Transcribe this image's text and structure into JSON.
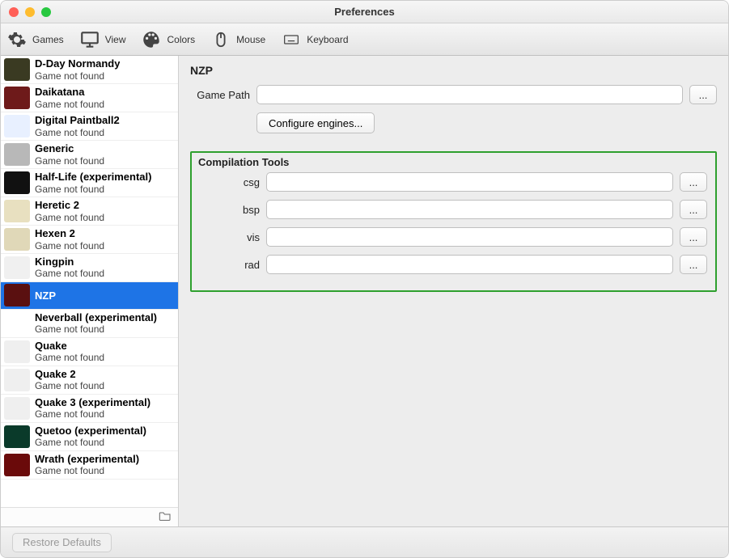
{
  "window": {
    "title": "Preferences"
  },
  "toolbar": {
    "games": "Games",
    "view": "View",
    "colors": "Colors",
    "mouse": "Mouse",
    "keyboard": "Keyboard"
  },
  "sidebar": {
    "not_found": "Game not found",
    "items": [
      {
        "name": "D-Day Normandy",
        "bg": "#3a3a22"
      },
      {
        "name": "Daikatana",
        "bg": "#6e1a1a"
      },
      {
        "name": "Digital Paintball2",
        "bg": "#e8f0ff"
      },
      {
        "name": "Generic",
        "bg": "#b8b8b8"
      },
      {
        "name": "Half-Life (experimental)",
        "bg": "#111"
      },
      {
        "name": "Heretic 2",
        "bg": "#e8e0c0"
      },
      {
        "name": "Hexen 2",
        "bg": "#e0d8b8"
      },
      {
        "name": "Kingpin",
        "bg": "#f0f0f0"
      },
      {
        "name": "NZP",
        "bg": "#5a1010",
        "selected": true,
        "hide_status": true
      },
      {
        "name": "Neverball (experimental)",
        "bg": "",
        "hide_icon": true
      },
      {
        "name": "Quake",
        "bg": "#efefef"
      },
      {
        "name": "Quake 2",
        "bg": "#efefef"
      },
      {
        "name": "Quake 3 (experimental)",
        "bg": "#efefef"
      },
      {
        "name": "Quetoo (experimental)",
        "bg": "#0a3a2a"
      },
      {
        "name": "Wrath (experimental)",
        "bg": "#6a0a0a"
      }
    ]
  },
  "main": {
    "heading": "NZP",
    "game_path_label": "Game Path",
    "configure_label": "Configure engines...",
    "browse_label": "...",
    "compilation_heading": "Compilation Tools",
    "tools": {
      "csg": "csg",
      "bsp": "bsp",
      "vis": "vis",
      "rad": "rad"
    }
  },
  "footer": {
    "restore_label": "Restore Defaults"
  }
}
